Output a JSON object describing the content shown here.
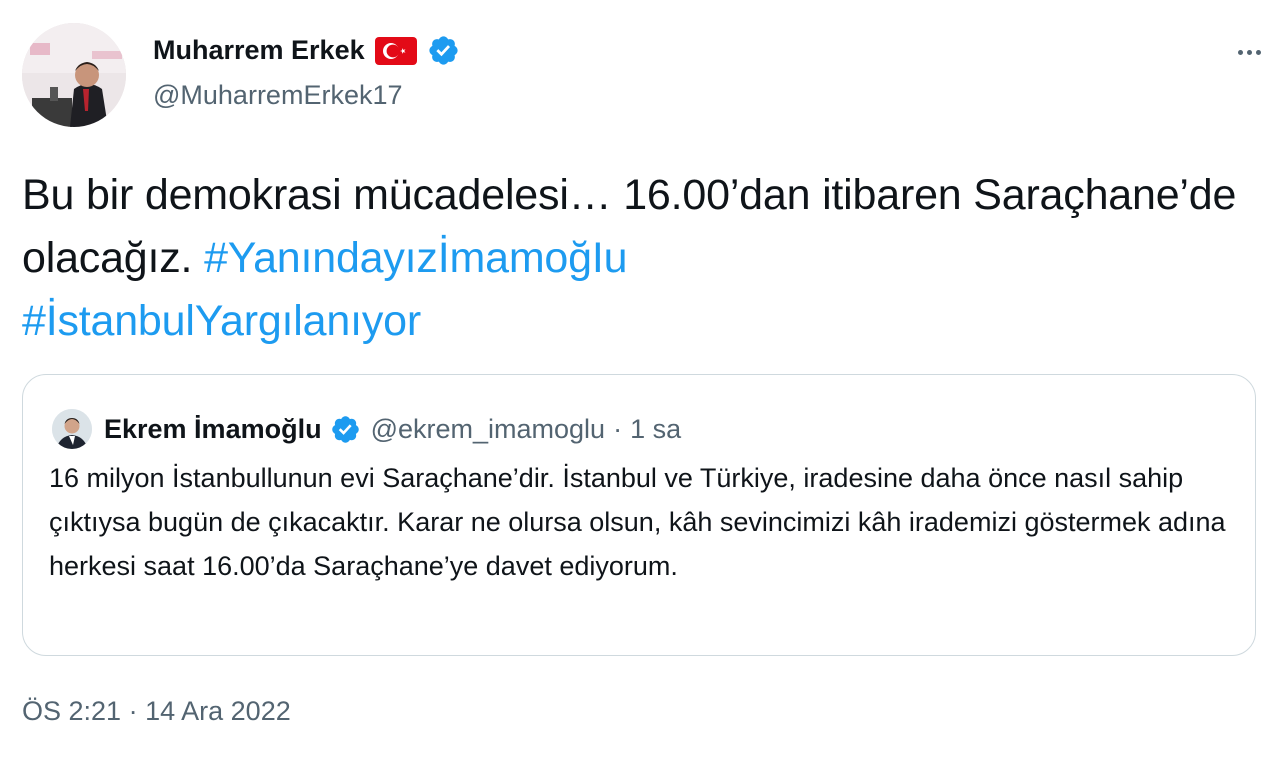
{
  "author": {
    "name": "Muharrem Erkek",
    "handle": "@MuharremErkek17",
    "flag_icon": "turkey-flag-icon",
    "verified_icon": "verified-badge-icon"
  },
  "menu": {
    "more_icon": "more-horizontal-icon"
  },
  "tweet": {
    "text_part1": "Bu bir demokrasi mücadelesi… 16.00’dan itibaren Saraçhane’de olacağız. ",
    "hashtag1": "#YanındayızİmamoğIu",
    "hashtag2": "#İstanbulYargılanıyor"
  },
  "quoted": {
    "name": "Ekrem İmamoğlu",
    "handle": "@ekrem_imamoglu",
    "separator": "·",
    "time": "1 sa",
    "text": "16 milyon İstanbullunun evi Saraçhane’dir. İstanbul ve Türkiye, iradesine daha önce nasıl sahip çıktıysa bugün de çıkacaktır. Karar ne olursa olsun, kâh sevincimizi kâh irademizi göstermek adına herkesi saat 16.00’da Saraçhane’ye davet ediyorum."
  },
  "meta": {
    "time": "ÖS 2:21",
    "separator": "·",
    "date": "14 Ara 2022"
  },
  "colors": {
    "link": "#1d9bf0",
    "secondary_text": "#536471",
    "border": "#cfd9de",
    "flag_red": "#e30a17",
    "verified_blue": "#1d9bf0"
  }
}
